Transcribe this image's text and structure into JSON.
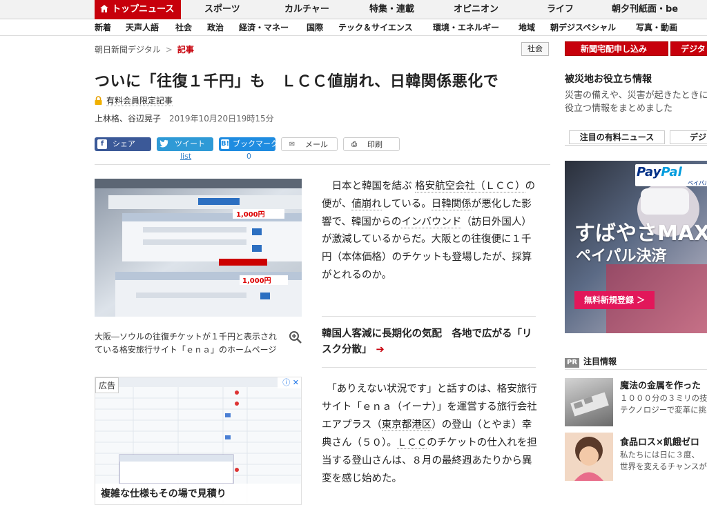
{
  "top_nav": {
    "items": [
      "トップニュース",
      "スポーツ",
      "カルチャー",
      "特集・連載",
      "オピニオン",
      "ライフ",
      "朝夕刊紙面・be"
    ]
  },
  "sub_nav": {
    "items": [
      "新着",
      "天声人語",
      "社会",
      "政治",
      "経済・マネー",
      "国際",
      "テック＆サイエンス",
      "環境・エネルギー",
      "地域",
      "朝デジスペシャル",
      "写真・動画"
    ]
  },
  "breadcrumb": {
    "site": "朝日新聞デジタル",
    "separator": ">",
    "current": "記事"
  },
  "section_badge": "社会",
  "article": {
    "title": "ついに「往復１千円」も　ＬＣＣ値崩れ、日韓関係悪化で",
    "paid_label": "有料会員限定記事",
    "authors": "上林格、谷辺晃子",
    "date": "2019年10月20日19時15分",
    "photo_caption": "大阪―ソウルの往復チケットが１千円と表示されている格安旅行サイト「ｅｎａ」のホームページ",
    "lead": {
      "p1": "日本と韓国を結ぶ",
      "l1": "格安航空会社（ＬＣＣ）",
      "p2": "の便が、",
      "l2": "値崩れ",
      "p3": "している。",
      "l3": "日韓関係",
      "p4": "が悪化した影響で、韓国からの",
      "l4": "インバウンド",
      "p5": "（訪日外国人）が激減しているからだ。大阪との往復便に１千円（本体価格）のチケットも登場したが、採算がとれるのか。"
    },
    "related": {
      "text": "韓国人客減に長期化の気配　各地で広がる「リスク分散」",
      "arrow": "➔"
    },
    "body2": {
      "p1": "「ありえない状況です」と話すのは、格安旅行サイト「ｅｎａ（イーナ）」を運営する旅行会社エアプラス（",
      "l1": "東京都港区",
      "p2": "）の登山（とやま）幸典さん（５０）。",
      "l2": "ＬＣＣ",
      "p3": "のチケットの仕入れを担当する登山さんは、８月の最終週あたりから異変を感じ始めた。"
    }
  },
  "share": {
    "facebook": "シェア",
    "twitter": "ツイート",
    "hatena": "ブックマーク",
    "mail": "メール",
    "print": "印刷",
    "twitter_count": "list",
    "hatena_count": "0"
  },
  "ad_left": {
    "label": "広告",
    "headline": "複雑な仕様もその場で見積り"
  },
  "right_rail": {
    "button1": "新聞宅配申し込み",
    "button2": "デジタ",
    "disaster_title": "被災地お役立ち情報",
    "disaster_text": "災害の備えや、災害が起きたときに役立つ情報をまとめました",
    "tab1": "注目の有料ニュース",
    "tab2": "デジ",
    "ad": {
      "brand_a": "Pay",
      "brand_b": "Pal",
      "brand_sub": "ペイパル",
      "headline1": "すばやさMAX",
      "headline2": "ペイパル決済",
      "cta": "無料新規登録 ＞"
    },
    "pr_label": "PR",
    "pr_title": "注目情報",
    "pr_items": [
      {
        "title": "魔法の金属を作った",
        "desc": "１０００分の３ミリの技 テクノロジーで変革に挑"
      },
      {
        "title": "食品ロス×飢餓ゼロ",
        "desc": "私たちには日に３度、 世界を変えるチャンスが"
      }
    ]
  },
  "colors": {
    "brand_red": "#c7000b",
    "facebook": "#3b5998",
    "twitter": "#2f9ad6",
    "hatena": "#1f8ce0"
  }
}
